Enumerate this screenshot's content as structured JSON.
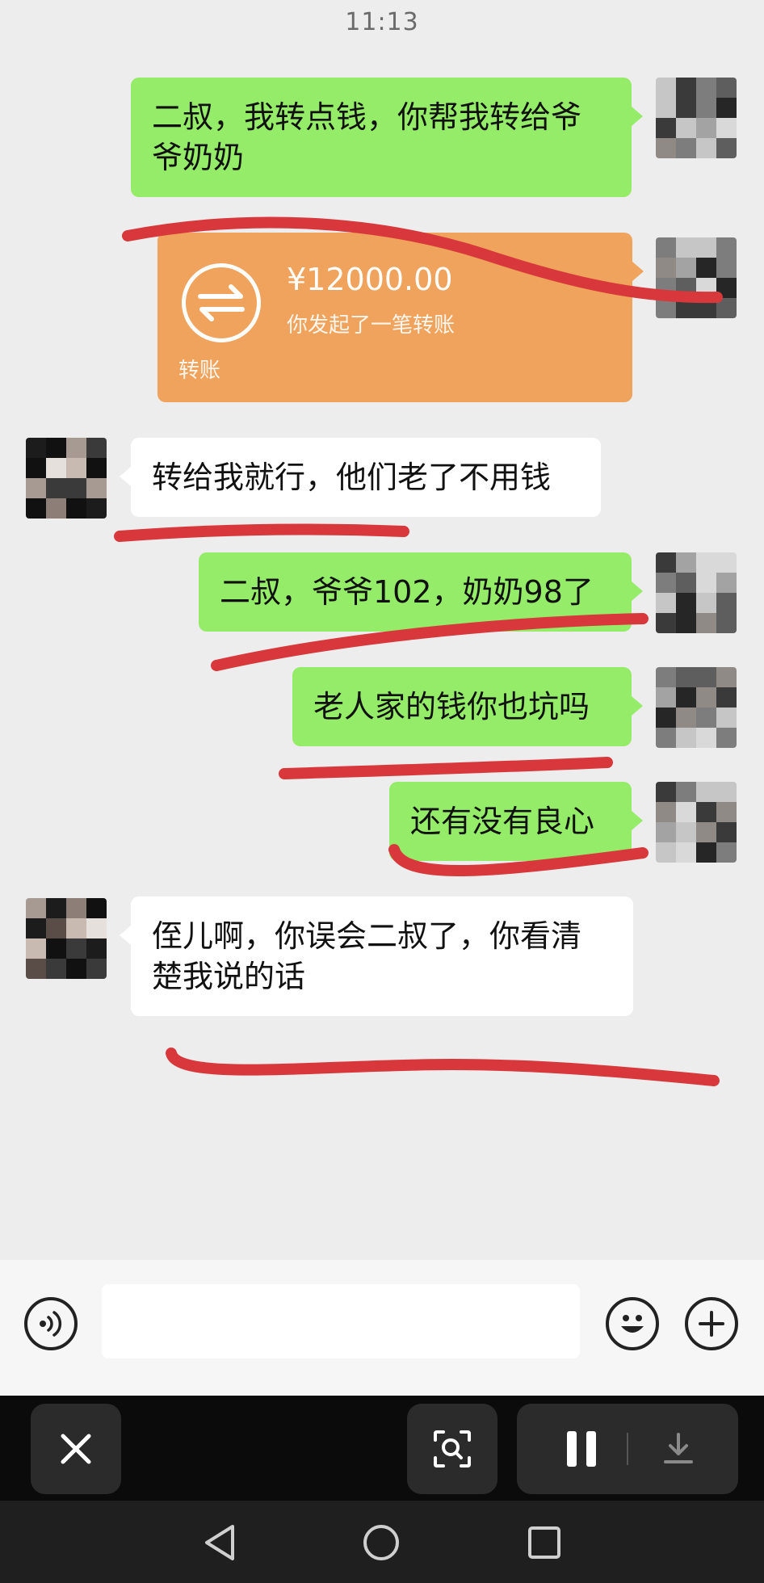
{
  "status_bar": {
    "time": "11:13"
  },
  "chat": {
    "msg1": {
      "line1": "二叔，我转点钱，你帮我转给爷",
      "line2": "爷奶奶"
    },
    "transfer": {
      "amount": "¥12000.00",
      "description": "你发起了一笔转账",
      "label": "转账",
      "icon": "transfer-arrows-icon"
    },
    "msg2": {
      "text": "转给我就行，他们老了不用钱"
    },
    "msg3": {
      "text": "二叔，爷爷102，奶奶98了"
    },
    "msg4": {
      "text": "老人家的钱你也坑吗"
    },
    "msg5": {
      "text": "还有没有良心"
    },
    "msg6": {
      "line1": "侄儿啊，你误会二叔了，你看清",
      "line2": "楚我说的话"
    }
  },
  "input_bar": {
    "voice_icon": "voice-icon",
    "emoji_icon": "emoji-icon",
    "plus_icon": "plus-icon"
  },
  "colors": {
    "bubble_me": "#95ec69",
    "bubble_them": "#ffffff",
    "transfer_card": "#f0a35c",
    "annotation_line": "#d8383b"
  }
}
